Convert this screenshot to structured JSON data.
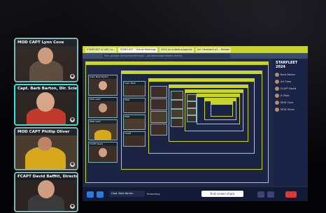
{
  "participants": [
    {
      "name": "MOD CAPT Lynn Cove",
      "active": false
    },
    {
      "name": "Capt. Barb Barton, Dir. Scien",
      "active": true
    },
    {
      "name": "MOD CAPT Phillip Oliver",
      "active": false
    },
    {
      "name": "FCAPT David Baffitt, Directo",
      "active": false
    }
  ],
  "browser": {
    "tabs": [
      "STARFLEET & USS Ca...",
      "STARFLEET - Virtual Meetings",
      "2024 Jul aufaktus/agenda",
      "Jun Cleveland s/1 - Meetall"
    ],
    "url": "docs.google.com/presentation/d/...gilt/dotstaupanskalon-eshleo"
  },
  "chat": {
    "title": "STARFLEET 2024",
    "rows": [
      "Barb Barton",
      "Art Crew",
      "FCAPT David",
      "Jf Ottoc",
      "MOD Cove",
      "MOD Oliver"
    ]
  },
  "meeting": {
    "presenter": "Capt. Barb Barton",
    "presenter_sub": "Presenting",
    "end_share": "End screen share"
  },
  "nested": {
    "names": [
      "Capt. Barb Barton",
      "MOD CAPT",
      "MOD CAPT",
      "FCAPT David"
    ],
    "level2_names": [
      "Capt. Barb",
      "MOD",
      "MOD",
      "FCAPT"
    ]
  },
  "colors": {
    "accent_yellow": "#c8d42e",
    "active_border": "#2ee6d6",
    "tile_border": "#7fb3b3",
    "share_bg": "#202845"
  }
}
